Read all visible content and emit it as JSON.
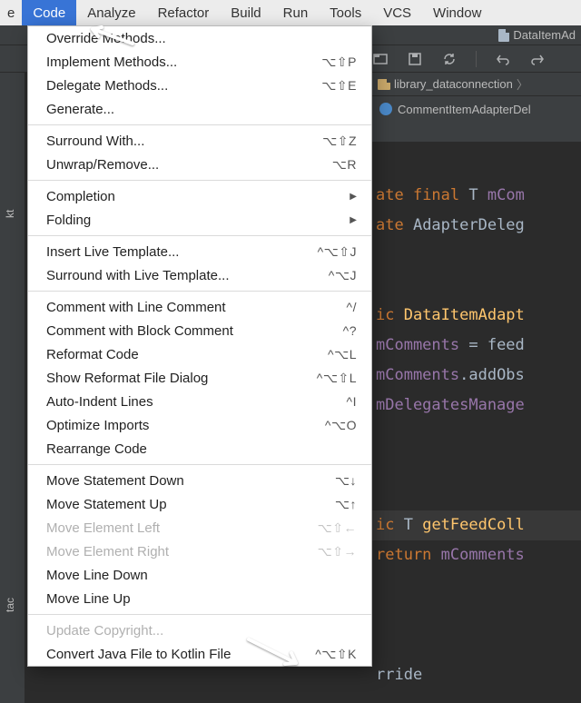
{
  "menubar": {
    "leading": "e",
    "items": [
      "Code",
      "Analyze",
      "Refactor",
      "Build",
      "Run",
      "Tools",
      "VCS",
      "Window"
    ],
    "active_index": 0
  },
  "topstrip": {
    "filename": "DataItemAd"
  },
  "breadcrumb": {
    "segment": "library_dataconnection",
    "chevron": "〉"
  },
  "tab": {
    "title": "CommentItemAdapterDel"
  },
  "sidebar": {
    "label1": "kt",
    "label2": "tac"
  },
  "code_lines": [
    {
      "parts": [
        {
          "t": ""
        }
      ],
      "cls": "blank"
    },
    {
      "parts": [
        {
          "t": "ate ",
          "c": "kw"
        },
        {
          "t": "final ",
          "c": "kw"
        },
        {
          "t": "T ",
          "c": "type"
        },
        {
          "t": "mCom",
          "c": "ident"
        }
      ]
    },
    {
      "parts": [
        {
          "t": "ate ",
          "c": "kw"
        },
        {
          "t": "AdapterDeleg",
          "c": "cls"
        }
      ]
    },
    {
      "parts": [
        {
          "t": ""
        }
      ],
      "cls": "blank"
    },
    {
      "parts": [
        {
          "t": ""
        }
      ],
      "cls": "blank"
    },
    {
      "parts": [
        {
          "t": "ic ",
          "c": "kw"
        },
        {
          "t": "DataItemAdapt",
          "c": "yellow"
        }
      ]
    },
    {
      "parts": [
        {
          "t": "mComments",
          "c": "ident"
        },
        {
          "t": " = feed",
          "c": "cls"
        }
      ]
    },
    {
      "parts": [
        {
          "t": "mComments",
          "c": "ident"
        },
        {
          "t": ".addObs",
          "c": "cls"
        }
      ]
    },
    {
      "parts": [
        {
          "t": "mDelegatesManage",
          "c": "ident"
        }
      ]
    },
    {
      "parts": [
        {
          "t": ""
        }
      ],
      "cls": "blank"
    },
    {
      "parts": [
        {
          "t": ""
        }
      ],
      "cls": "blank"
    },
    {
      "parts": [
        {
          "t": ""
        }
      ],
      "cls": "blank"
    },
    {
      "parts": [
        {
          "t": "ic ",
          "c": "kw"
        },
        {
          "t": "T ",
          "c": "type"
        },
        {
          "t": "getFeedColl",
          "c": "yellow"
        }
      ],
      "hl": true
    },
    {
      "parts": [
        {
          "t": "return ",
          "c": "kw"
        },
        {
          "t": "mComments",
          "c": "ident"
        }
      ]
    },
    {
      "parts": [
        {
          "t": ""
        }
      ],
      "cls": "blank"
    },
    {
      "parts": [
        {
          "t": ""
        }
      ],
      "cls": "blank"
    },
    {
      "parts": [
        {
          "t": ""
        }
      ],
      "cls": "blank"
    },
    {
      "parts": [
        {
          "t": "rride",
          "c": "cls"
        }
      ]
    }
  ],
  "menu": {
    "groups": [
      [
        {
          "label": "Override Methods...",
          "scut": "",
          "enabled": true
        },
        {
          "label": "Implement Methods...",
          "scut": "⌥⇧P",
          "enabled": true
        },
        {
          "label": "Delegate Methods...",
          "scut": "⌥⇧E",
          "enabled": true
        },
        {
          "label": "Generate...",
          "scut": "",
          "enabled": true
        }
      ],
      [
        {
          "label": "Surround With...",
          "scut": "⌥⇧Z",
          "enabled": true
        },
        {
          "label": "Unwrap/Remove...",
          "scut": "⌥R",
          "enabled": true
        }
      ],
      [
        {
          "label": "Completion",
          "scut": "",
          "enabled": true,
          "sub": true
        },
        {
          "label": "Folding",
          "scut": "",
          "enabled": true,
          "sub": true
        }
      ],
      [
        {
          "label": "Insert Live Template...",
          "scut": "^⌥⇧J",
          "enabled": true
        },
        {
          "label": "Surround with Live Template...",
          "scut": "^⌥J",
          "enabled": true
        }
      ],
      [
        {
          "label": "Comment with Line Comment",
          "scut": "^/",
          "enabled": true
        },
        {
          "label": "Comment with Block Comment",
          "scut": "^?",
          "enabled": true
        },
        {
          "label": "Reformat Code",
          "scut": "^⌥L",
          "enabled": true
        },
        {
          "label": "Show Reformat File Dialog",
          "scut": "^⌥⇧L",
          "enabled": true
        },
        {
          "label": "Auto-Indent Lines",
          "scut": "^I",
          "enabled": true
        },
        {
          "label": "Optimize Imports",
          "scut": "^⌥O",
          "enabled": true
        },
        {
          "label": "Rearrange Code",
          "scut": "",
          "enabled": true
        }
      ],
      [
        {
          "label": "Move Statement Down",
          "scut": "⌥↓",
          "enabled": true
        },
        {
          "label": "Move Statement Up",
          "scut": "⌥↑",
          "enabled": true
        },
        {
          "label": "Move Element Left",
          "scut": "⌥⇧←",
          "enabled": false
        },
        {
          "label": "Move Element Right",
          "scut": "⌥⇧→",
          "enabled": false
        },
        {
          "label": "Move Line Down",
          "scut": "",
          "enabled": true
        },
        {
          "label": "Move Line Up",
          "scut": "",
          "enabled": true
        }
      ],
      [
        {
          "label": "Update Copyright...",
          "scut": "",
          "enabled": false
        },
        {
          "label": "Convert Java File to Kotlin File",
          "scut": "^⌥⇧K",
          "enabled": true
        }
      ]
    ]
  }
}
